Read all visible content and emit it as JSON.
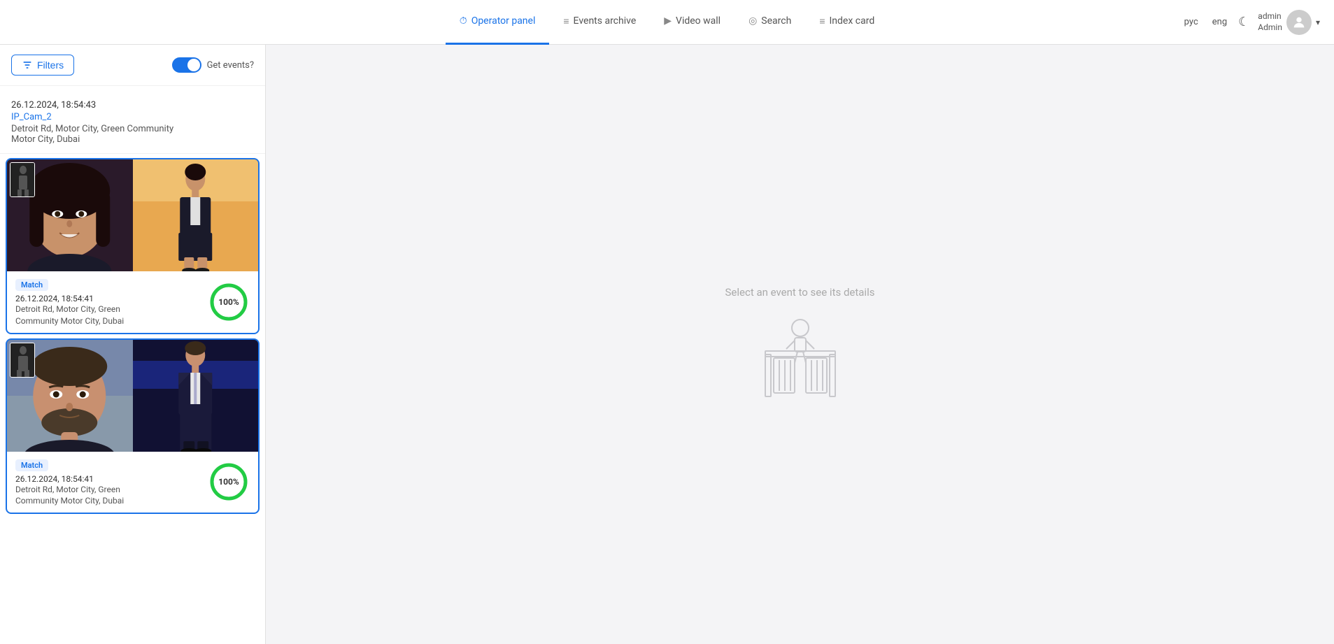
{
  "header": {
    "nav": [
      {
        "id": "operator-panel",
        "label": "Operator panel",
        "icon": "⏱",
        "active": true
      },
      {
        "id": "events-archive",
        "label": "Events archive",
        "icon": "≡",
        "active": false
      },
      {
        "id": "video-wall",
        "label": "Video wall",
        "icon": "▶",
        "active": false
      },
      {
        "id": "search",
        "label": "Search",
        "icon": "◎",
        "active": false
      },
      {
        "id": "index-card",
        "label": "Index card",
        "icon": "≡",
        "active": false
      }
    ],
    "lang_ru": "рус",
    "lang_eng": "eng",
    "theme_icon": "☾",
    "user": {
      "name": "admin",
      "role": "Admin"
    }
  },
  "sidebar": {
    "filters_label": "Filters",
    "get_events_label": "Get events?",
    "toggle_on": true
  },
  "events": [
    {
      "type": "info",
      "timestamp": "26.12.2024, 18:54:43",
      "camera": "IP_Cam_2",
      "location_line1": "Detroit Rd, Motor City, Green Community",
      "location_line2": "Motor City, Dubai"
    },
    {
      "type": "match",
      "badge": "Match",
      "timestamp": "26.12.2024, 18:54:41",
      "location_line1": "Detroit Rd, Motor City, Green",
      "location_line2": "Community Motor City, Dubai",
      "percent": 100,
      "person_id": "person1"
    },
    {
      "type": "match",
      "badge": "Match",
      "timestamp": "26.12.2024, 18:54:41",
      "location_line1": "Detroit Rd, Motor City, Green",
      "location_line2": "Community Motor City, Dubai",
      "percent": 100,
      "person_id": "person2"
    }
  ],
  "content": {
    "empty_label": "Select an event to see its details"
  }
}
